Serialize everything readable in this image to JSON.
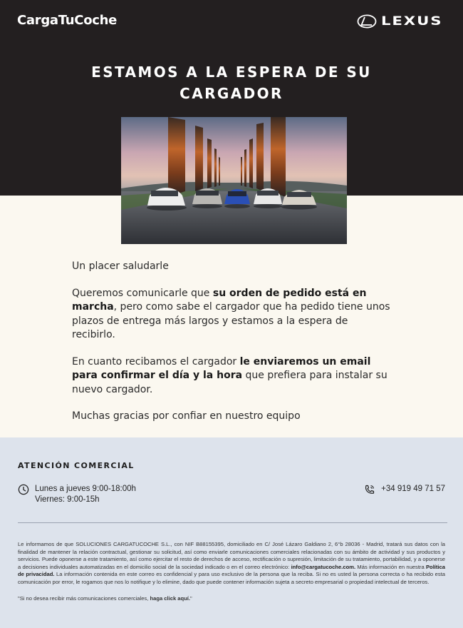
{
  "header": {
    "brand": "CargaTuCoche",
    "partner_logo": "LEXUS",
    "title_line1": "ESTAMOS A LA ESPERA DE SU",
    "title_line2": "CARGADOR"
  },
  "hero": {
    "icon": "cars-row-photo"
  },
  "body": {
    "greeting": "Un placer saludarle",
    "p1_a": "Queremos comunicarle que ",
    "p1_b": "su orden de pedido está en marcha",
    "p1_c": ", pero como sabe el cargador que ha pedido tiene unos plazos de entrega más largos y estamos a la espera de recibirlo.",
    "p2_a": "En cuanto recibamos el cargador ",
    "p2_b": "le enviaremos un email para confirmar el día y la hora",
    "p2_c": " que prefiera para instalar su nuevo cargador.",
    "closing": "Muchas gracias por confiar en nuestro equipo"
  },
  "footer": {
    "heading": "ATENCIÓN COMERCIAL",
    "hours_1": "Lunes a jueves 9:00-18:00h",
    "hours_2": "Viernes: 9:00-15h",
    "phone": "+34 919 49 71 57",
    "legal_a": "Le informamos de que SOLUCIONES CARGATUCOCHE S.L., con NIF B88155395, domiciliado en C/ José Lázaro Galdiano 2, 6°b 28036 - Madrid, tratará sus datos con la finalidad de mantener la relación contractual, gestionar su solicitud, así como enviarle comunicaciones comerciales relacionadas con su ámbito de actividad y sus productos y servicios. Puede oponerse a este tratamiento, así como ejercitar el resto de derechos de acceso, rectificación o supresión, limitación de su tratamiento, portabilidad, y a oponerse a decisiones individuales automatizadas en el domicilio social de la sociedad indicado o en el correo electrónico: ",
    "legal_email": "info@cargatucoche.com.",
    "legal_b": " Más información en nuestra ",
    "legal_policy": "Política de privacidad.",
    "legal_c": " La información contenida en este correo es confidencial y para uso exclusivo de la persona que la reciba. Si no es usted la persona correcta o ha recibido esta comunicación por error, le rogamos que nos lo notifique y lo elimine, dado que puede contener información sujeta a secreto empresarial o propiedad intelectual de terceros.",
    "unsub_a": "\"Si no desea recibir más comunicaciones comerciales, ",
    "unsub_link": "haga click aquí.",
    "unsub_b": "\""
  },
  "colors": {
    "header_bg": "#231f20",
    "body_bg": "#fbf8f0",
    "footer_bg": "#dde3ec"
  }
}
